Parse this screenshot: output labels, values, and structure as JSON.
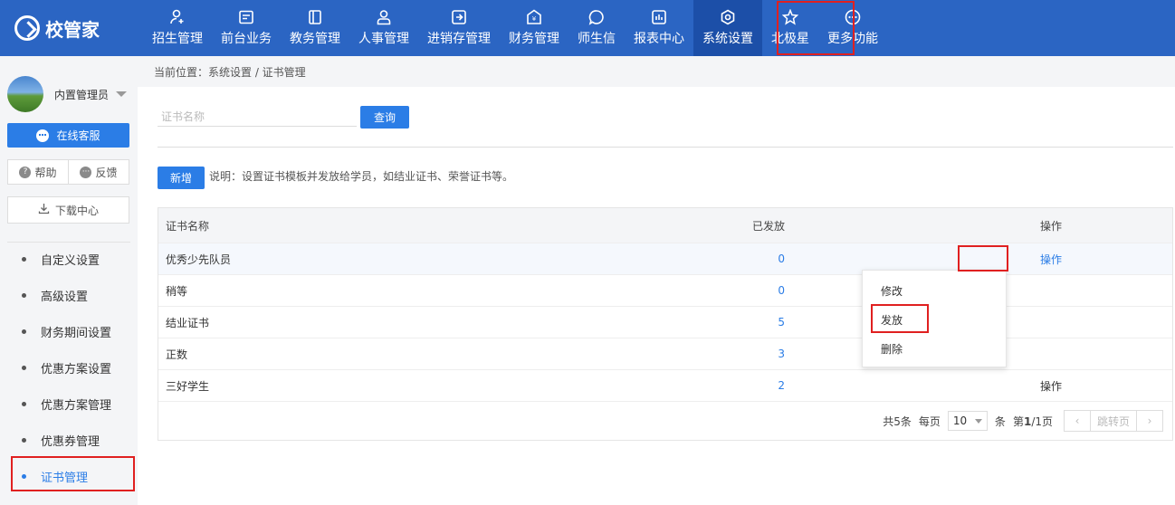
{
  "app": {
    "logo_text": "校管家"
  },
  "nav": [
    {
      "label": "招生管理",
      "icon": "user-add-icon"
    },
    {
      "label": "前台业务",
      "icon": "card-icon"
    },
    {
      "label": "教务管理",
      "icon": "book-icon"
    },
    {
      "label": "人事管理",
      "icon": "person-icon"
    },
    {
      "label": "进销存管理",
      "icon": "inventory-icon"
    },
    {
      "label": "财务管理",
      "icon": "money-icon"
    },
    {
      "label": "师生信",
      "icon": "chat-icon"
    },
    {
      "label": "报表中心",
      "icon": "report-icon"
    },
    {
      "label": "系统设置",
      "icon": "settings-icon",
      "active": true
    },
    {
      "label": "北极星",
      "icon": "star-icon"
    },
    {
      "label": "更多功能",
      "icon": "more-icon"
    }
  ],
  "sidebar": {
    "user_name": "内置管理员",
    "service_label": "在线客服",
    "help_label": "帮助",
    "feedback_label": "反馈",
    "download_label": "下载中心",
    "menu": [
      {
        "label": "自定义设置"
      },
      {
        "label": "高级设置"
      },
      {
        "label": "财务期间设置"
      },
      {
        "label": "优惠方案设置"
      },
      {
        "label": "优惠方案管理"
      },
      {
        "label": "优惠券管理"
      },
      {
        "label": "证书管理",
        "active": true
      }
    ]
  },
  "breadcrumb": "当前位置：系统设置 / 证书管理",
  "search": {
    "placeholder": "证书名称",
    "value": "",
    "button": "查询"
  },
  "toolbar": {
    "new_button": "新增",
    "note": "说明：设置证书模板并发放给学员，如结业证书、荣誉证书等。"
  },
  "table": {
    "columns": [
      "证书名称",
      "已发放",
      "操作"
    ],
    "rows": [
      {
        "name": "优秀少先队员",
        "issued": "0",
        "action": "操作"
      },
      {
        "name": "稍等",
        "issued": "0",
        "action": ""
      },
      {
        "name": "结业证书",
        "issued": "5",
        "action": ""
      },
      {
        "name": "正数",
        "issued": "3",
        "action": ""
      },
      {
        "name": "三好学生",
        "issued": "2",
        "action": "操作"
      }
    ]
  },
  "pagination": {
    "total": "共5条",
    "per_page_label": "每页",
    "per_page_value": "10",
    "per_page_unit": "条",
    "page_prefix": "第",
    "page_current": "1",
    "page_suffix": "/1页",
    "jump_label": "跳转页"
  },
  "dropdown": [
    {
      "label": "修改"
    },
    {
      "label": "发放"
    },
    {
      "label": "删除"
    }
  ],
  "colors": {
    "nav_bg": "#2b65c3",
    "primary": "#2b7de6",
    "highlight": "#e02020"
  }
}
